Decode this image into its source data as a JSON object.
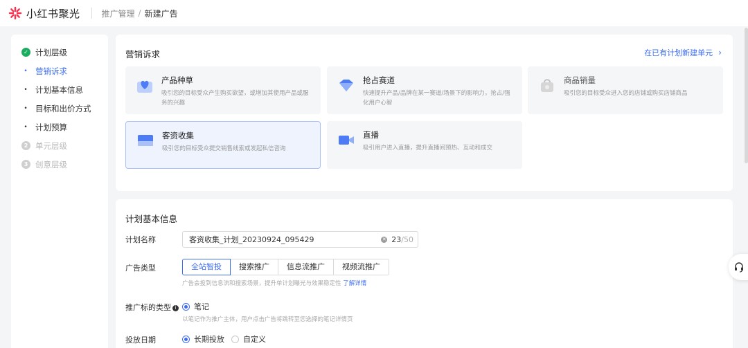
{
  "header": {
    "app_name": "小红书聚光",
    "breadcrumb": {
      "parent": "推广管理",
      "separator": "/",
      "current": "新建广告"
    }
  },
  "nav": {
    "levels": [
      {
        "label": "计划层级",
        "badge": "✓",
        "state": "done"
      },
      {
        "label": "营销诉求",
        "state": "active",
        "sub": true
      },
      {
        "label": "计划基本信息",
        "state": "normal",
        "sub": true
      },
      {
        "label": "目标和出价方式",
        "state": "normal",
        "sub": true
      },
      {
        "label": "计划预算",
        "state": "normal",
        "sub": true
      },
      {
        "label": "单元层级",
        "badge": "2",
        "state": "disabled"
      },
      {
        "label": "创意层级",
        "badge": "3",
        "state": "disabled"
      }
    ],
    "bullet": "•"
  },
  "marketing": {
    "title": "营销诉求",
    "link": "在已有计划新建单元",
    "cards": [
      {
        "title": "产品种草",
        "desc": "吸引您的目标受众产生购买欲望，或增加其使用产品或服务的兴趣"
      },
      {
        "title": "抢占赛道",
        "desc": "快速提升产品/品牌在某一赛道/场景下的影响力，抢占/强化用户心智"
      },
      {
        "title": "商品销量",
        "desc": "吸引您的目标受众进入您的店铺或购买店铺商品"
      },
      {
        "title": "客资收集",
        "desc": "吸引您的目标受众提交销售线索或发起私信咨询"
      },
      {
        "title": "直播",
        "desc": "吸引用户进入直播，提升直播间预热、互动和成交"
      }
    ]
  },
  "basic": {
    "title": "计划基本信息",
    "name_label": "计划名称",
    "name_value": "客资收集_计划_20230924_095429",
    "count_current": "23",
    "count_max": "/50",
    "type_label": "广告类型",
    "type_options": [
      "全站智投",
      "搜索推广",
      "信息流推广",
      "视频流推广"
    ],
    "type_hint": "广告会投到信息流和搜索场景，提升单计划曝光与效果稳定性",
    "type_hint_link": "了解详情",
    "target_label": "推广标的类型",
    "target_option": "笔记",
    "target_hint": "以笔记作为推广主体，用户点击广告将跳转至您选择的笔记详情页",
    "date_label": "投放日期",
    "date_options": [
      "长期投放",
      "自定义"
    ]
  },
  "colors": {
    "accent": "#3d6df2",
    "success": "#1aad5f",
    "logo": "#ff2e4d"
  }
}
